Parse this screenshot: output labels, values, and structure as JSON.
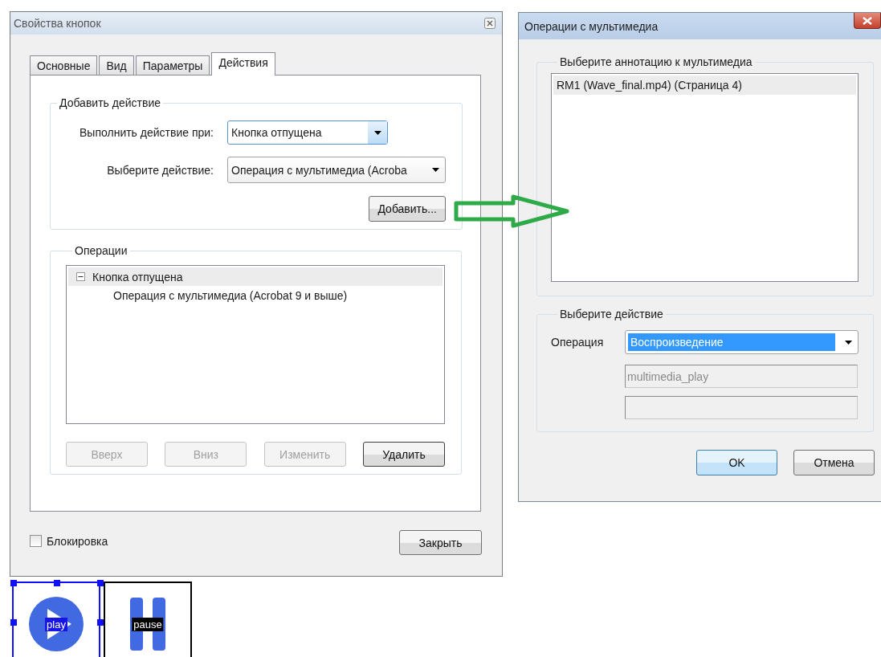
{
  "buttons_dialog": {
    "title": "Свойства кнопок",
    "tabs": [
      {
        "label": "Основные",
        "selected": false
      },
      {
        "label": "Вид",
        "selected": false
      },
      {
        "label": "Параметры",
        "selected": false
      },
      {
        "label": "Действия",
        "selected": true
      }
    ],
    "add_action": {
      "legend": "Добавить действие",
      "trigger_label": "Выполнить действие при:",
      "trigger_value": "Кнопка отпущена",
      "action_label": "Выберите действие:",
      "action_value": "Операция с мультимедиа (Acroba",
      "add_button": "Добавить..."
    },
    "operations": {
      "legend": "Операции",
      "tree": [
        {
          "label": "Кнопка отпущена",
          "expanded": true,
          "children": [
            {
              "label": "Операция с мультимедиа (Acrobat 9 и выше)"
            }
          ]
        }
      ],
      "buttons": [
        {
          "label": "Вверх",
          "disabled": true
        },
        {
          "label": "Вниз",
          "disabled": true
        },
        {
          "label": "Изменить",
          "disabled": true
        },
        {
          "label": "Удалить",
          "disabled": false
        }
      ]
    },
    "lock": {
      "label": "Блокировка",
      "checked": false
    },
    "close_button": "Закрыть"
  },
  "multimedia_dialog": {
    "title": "Операции с мультимедиа",
    "annotation_group": {
      "legend": "Выберите аннотацию к мультимедиа",
      "items": [
        {
          "label": "RM1 (Wave_final.mp4) (Страница 4)",
          "selected": true
        }
      ]
    },
    "action_group": {
      "legend": "Выберите действие",
      "operation_label": "Операция",
      "operation_value": "Воспроизведение",
      "script_field": {
        "value": "multimedia_play",
        "disabled": true
      }
    },
    "buttons": [
      {
        "label": "OK",
        "default": true
      },
      {
        "label": "Отмена",
        "default": false
      }
    ]
  },
  "page_buttons": [
    {
      "kind": "play",
      "label": "play",
      "selected": true
    },
    {
      "kind": "pause",
      "label": "pause",
      "selected": false
    }
  ]
}
